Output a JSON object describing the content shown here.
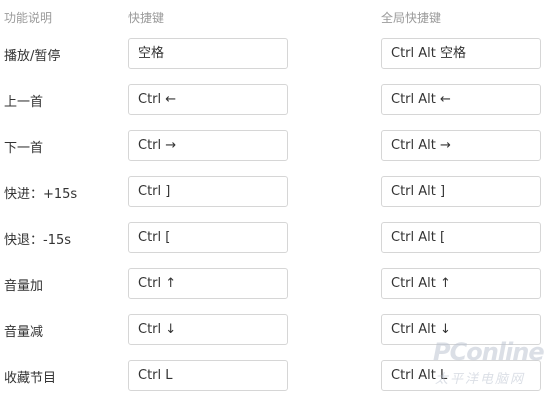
{
  "headers": {
    "function": "功能说明",
    "local": "快捷键",
    "global": "全局快捷键"
  },
  "rows": [
    {
      "label": "播放/暂停",
      "local": "空格",
      "global": "Ctrl Alt 空格"
    },
    {
      "label": "上一首",
      "local": "Ctrl ←",
      "global": "Ctrl Alt ←"
    },
    {
      "label": "下一首",
      "local": "Ctrl →",
      "global": "Ctrl Alt →"
    },
    {
      "label": "快进：+15s",
      "local": "Ctrl ]",
      "global": "Ctrl Alt ]"
    },
    {
      "label": "快退：-15s",
      "local": "Ctrl [",
      "global": "Ctrl Alt ["
    },
    {
      "label": "音量加",
      "local": "Ctrl ↑",
      "global": "Ctrl Alt ↑"
    },
    {
      "label": "音量减",
      "local": "Ctrl ↓",
      "global": "Ctrl Alt ↓"
    },
    {
      "label": "收藏节目",
      "local": "Ctrl L",
      "global": "Ctrl Alt L"
    }
  ],
  "watermark": {
    "brand": "PConline",
    "tagline": "太平洋电脑网"
  }
}
